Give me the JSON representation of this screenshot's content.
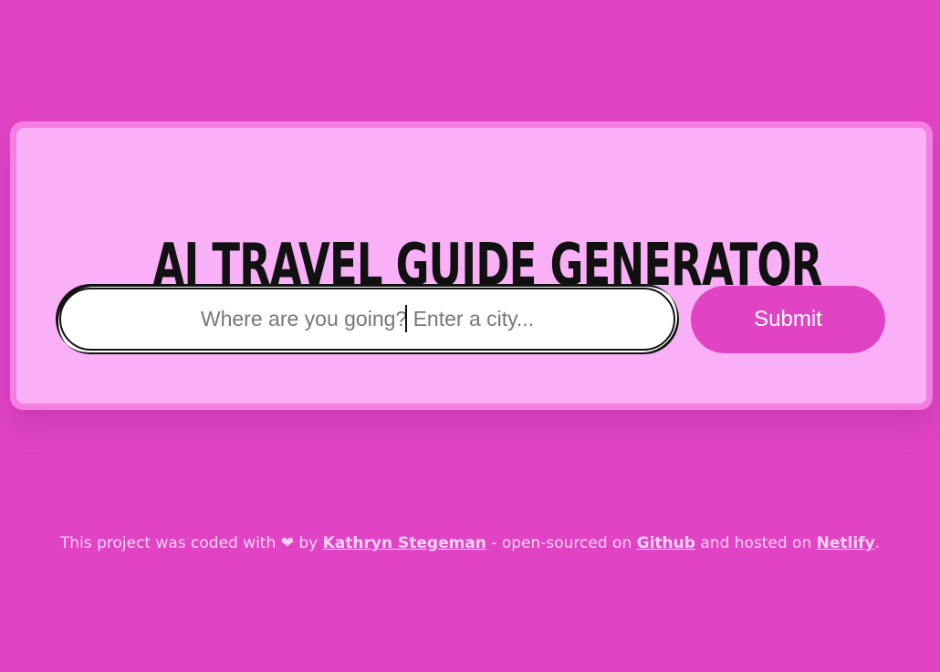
{
  "app": {
    "title": "AI TRAVEL GUIDE GENERATOR"
  },
  "search": {
    "placeholder": "Where are you going? Enter a city...",
    "value": ""
  },
  "submit": {
    "label": "Submit"
  },
  "footer": {
    "text_1": "This project was coded with",
    "heart_icon": "heart-icon",
    "text_2": "by",
    "author": "Kathryn Stegeman",
    "text_3": "- open-sourced on",
    "github": "Github",
    "text_4": "and hosted on",
    "netlify": "Netlify",
    "text_5": "."
  },
  "colors": {
    "background": "#e044c5",
    "card_border": "#f57ee2",
    "card_fill": "#f9b0f6",
    "button": "#e044c5",
    "footer_text": "#fbd0f2"
  }
}
